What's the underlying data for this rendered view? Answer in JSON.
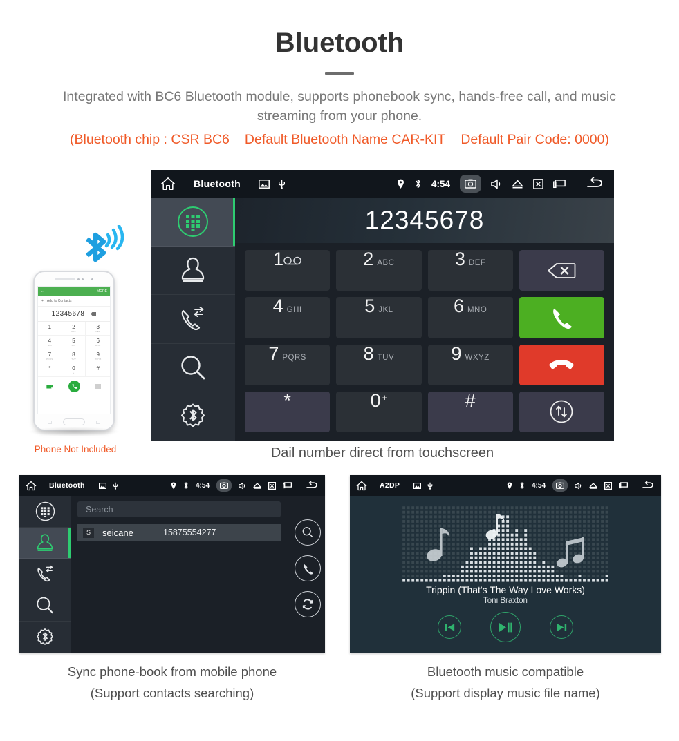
{
  "hero": {
    "title": "Bluetooth",
    "subtitle": "Integrated with BC6 Bluetooth module, supports phonebook sync, hands-free call, and music streaming from your phone.",
    "note_chip": "(Bluetooth chip : CSR BC6",
    "note_name": "Default Bluetooth Name CAR-KIT",
    "note_pair": "Default Pair Code: 0000)",
    "note_color": "#f05a28"
  },
  "statusbar": {
    "title_dialer": "Bluetooth",
    "title_contacts": "Bluetooth",
    "title_music": "A2DP",
    "time": "4:54",
    "icons_left": [
      "home-icon",
      "gallery-icon",
      "usb-icon"
    ],
    "icons_right": [
      "location-pin-icon",
      "bluetooth-icon",
      "screenshot-icon",
      "volume-icon",
      "eject-icon",
      "close-window-icon",
      "recents-icon",
      "back-arrow-icon"
    ]
  },
  "sidebar": {
    "items": [
      {
        "name": "dialpad",
        "label": "Dialpad",
        "active": true
      },
      {
        "name": "contacts",
        "label": "Contacts",
        "active": false
      },
      {
        "name": "call-history",
        "label": "Call history",
        "active": false
      },
      {
        "name": "search",
        "label": "Search",
        "active": false
      },
      {
        "name": "bluetooth-settings",
        "label": "Bluetooth settings",
        "active": false
      }
    ],
    "active_color": "#2ecc71"
  },
  "dialer": {
    "number": "12345678",
    "keys": [
      {
        "digit": "1",
        "letters": "",
        "voicemail": true,
        "style": "normal"
      },
      {
        "digit": "2",
        "letters": "ABC",
        "style": "normal"
      },
      {
        "digit": "3",
        "letters": "DEF",
        "style": "normal"
      },
      {
        "digit": "",
        "letters": "",
        "style": "alt",
        "icon": "backspace-icon"
      },
      {
        "digit": "4",
        "letters": "GHI",
        "style": "normal"
      },
      {
        "digit": "5",
        "letters": "JKL",
        "style": "normal"
      },
      {
        "digit": "6",
        "letters": "MNO",
        "style": "normal"
      },
      {
        "digit": "",
        "letters": "",
        "style": "green",
        "icon": "call-icon"
      },
      {
        "digit": "7",
        "letters": "PQRS",
        "style": "normal"
      },
      {
        "digit": "8",
        "letters": "TUV",
        "style": "normal"
      },
      {
        "digit": "9",
        "letters": "WXYZ",
        "style": "normal"
      },
      {
        "digit": "",
        "letters": "",
        "style": "red",
        "icon": "hangup-icon"
      },
      {
        "digit": "*",
        "letters": "",
        "style": "alt"
      },
      {
        "digit": "0",
        "letters": "",
        "sup": "+",
        "style": "normal"
      },
      {
        "digit": "#",
        "letters": "",
        "style": "alt"
      },
      {
        "digit": "",
        "letters": "",
        "style": "alt",
        "icon": "transfer-audio-icon"
      }
    ],
    "caption": "Dail number direct from touchscreen",
    "call_color": "#4caf22",
    "hangup_color": "#e03a2a"
  },
  "phone_mock": {
    "appbar_back": "←",
    "appbar_more": "MORE",
    "add_to_contacts": "Add to Contacts",
    "number": "12345678",
    "keys": [
      {
        "d": "1",
        "l": ""
      },
      {
        "d": "2",
        "l": "ABC"
      },
      {
        "d": "3",
        "l": "DEF"
      },
      {
        "d": "4",
        "l": "GHI"
      },
      {
        "d": "5",
        "l": "JKL"
      },
      {
        "d": "6",
        "l": "MNO"
      },
      {
        "d": "7",
        "l": "PQRS"
      },
      {
        "d": "8",
        "l": "TUV"
      },
      {
        "d": "9",
        "l": "WXYZ"
      },
      {
        "d": "*",
        "l": ""
      },
      {
        "d": "0",
        "l": "+"
      },
      {
        "d": "#",
        "l": ""
      }
    ],
    "not_included_label": "Phone Not Included",
    "accent_color": "#4CAF50"
  },
  "contacts": {
    "search_placeholder": "Search",
    "rows": [
      {
        "badge": "S",
        "name": "seicane",
        "number": "15875554277"
      }
    ],
    "actions": [
      "search-icon",
      "call-icon",
      "sync-icon"
    ],
    "caption_line1": "Sync phone-book from mobile phone",
    "caption_line2": "(Support contacts searching)"
  },
  "music": {
    "track_title": "Trippin (That's The Way Love Works)",
    "artist": "Toni Braxton",
    "controls": [
      "previous-icon",
      "play-pause-icon",
      "next-icon"
    ],
    "control_color": "#2fa46a",
    "caption_line1": "Bluetooth music compatible",
    "caption_line2": "(Support display music file name)"
  }
}
